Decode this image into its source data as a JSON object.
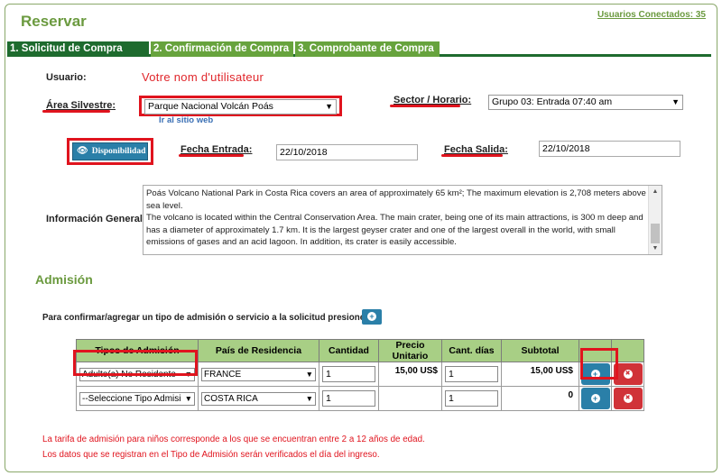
{
  "header": {
    "title": "Reservar",
    "users_connected": "Usuarios Conectados: 35"
  },
  "tabs": [
    {
      "label": "1. Solicitud de Compra",
      "active": true
    },
    {
      "label": "2. Confirmación de Compra",
      "active": false
    },
    {
      "label": "3. Comprobante de Compra",
      "active": false
    }
  ],
  "form": {
    "usuario_label": "Usuario:",
    "usuario_value": "Votre nom d'utilisateur",
    "area_label": "Área Silvestre:",
    "area_value": "Parque Nacional Volcán Poás",
    "site_link": "Ir al sitio web",
    "sector_label": "Sector / Horario:",
    "sector_value": "Grupo 03: Entrada 07:40 am",
    "disponibilidad_label": "Disponibilidad",
    "fecha_entrada_label": "Fecha Entrada:",
    "fecha_entrada_value": "22/10/2018",
    "fecha_salida_label": "Fecha Salida:",
    "fecha_salida_value": "22/10/2018",
    "info_label": "Información General:",
    "info_text": "Poás Volcano National Park in Costa Rica covers an area of approximately 65 km²; The maximum elevation is 2,708 meters above sea level.\nThe volcano is located within the Central Conservation Area. The main crater, being one of its main attractions, is 300 m deep and has a diameter of approximately 1.7 km. It is the largest geyser crater and one of the largest overall in the world, with small emissions of gases and an acid lagoon. In addition, its crater is easily accessible."
  },
  "admision": {
    "title": "Admisión",
    "instruction": "Para confirmar/agregar un tipo de admisión o servicio a la solicitud presione",
    "columns": [
      "Tipos de Admisión",
      "País de Residencia",
      "Cantidad",
      "Precio Unitario",
      "Cant. días",
      "Subtotal",
      "",
      ""
    ],
    "rows": [
      {
        "tipo": "Adulto(a) No Residente",
        "pais": "FRANCE",
        "cantidad": "1",
        "precio": "15,00 US$",
        "dias": "1",
        "subtotal": "15,00 US$"
      },
      {
        "tipo": "--Seleccione Tipo Admisi",
        "pais": "COSTA RICA",
        "cantidad": "1",
        "precio": "",
        "dias": "1",
        "subtotal": "0"
      }
    ]
  },
  "notes": [
    "La tarifa de admisión para niños corresponde a los que se encuentran entre 2 a 12 años de edad.",
    "Los datos que se registran en el Tipo de Admisión serán verificados el día del ingreso."
  ],
  "icons": {
    "select_arrow": "▼",
    "eye": "👁",
    "plus": "+",
    "close": "✖"
  },
  "colors": {
    "accent_green": "#6b9a3f",
    "tab_active": "#1e6b2e",
    "tab_inactive": "#67a33d",
    "button_blue": "#2a7fa8",
    "button_red": "#d03238",
    "highlight_red": "#e0141e",
    "table_header": "#a8cf85"
  }
}
